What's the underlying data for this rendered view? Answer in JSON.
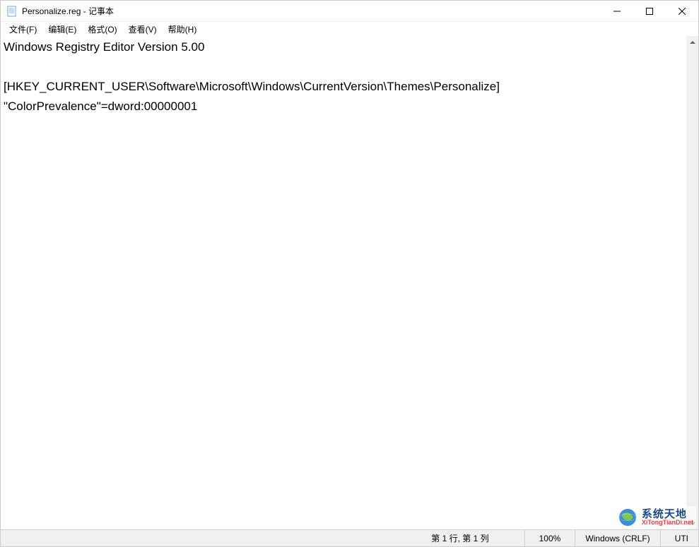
{
  "titlebar": {
    "title": "Personalize.reg - 记事本"
  },
  "menu": {
    "file": "文件(F)",
    "edit": "编辑(E)",
    "format": "格式(O)",
    "view": "查看(V)",
    "help": "帮助(H)"
  },
  "editor": {
    "content": "Windows Registry Editor Version 5.00\n\n[HKEY_CURRENT_USER\\Software\\Microsoft\\Windows\\CurrentVersion\\Themes\\Personalize]\n\"ColorPrevalence\"=dword:00000001"
  },
  "statusbar": {
    "position": "第 1 行, 第 1 列",
    "zoom": "100%",
    "line_ending": "Windows (CRLF)",
    "encoding": "UTI"
  },
  "watermark": {
    "main": "系统天地",
    "sub": "XiTongTianDi.net"
  }
}
